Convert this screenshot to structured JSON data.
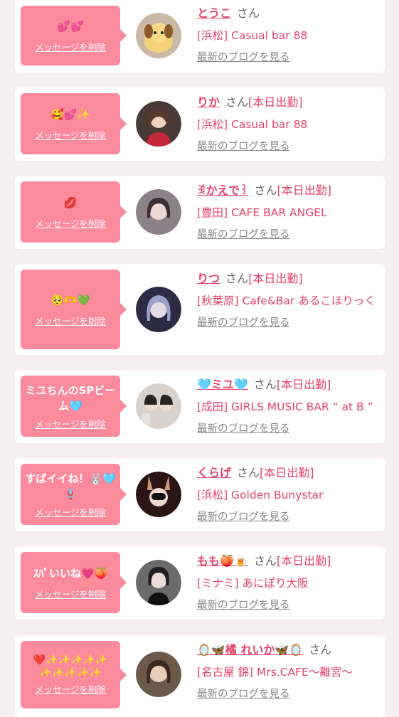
{
  "delete_label": "メッセージを削除",
  "san_label": "さん",
  "blog_label": "最新のブログを見る",
  "cards": [
    {
      "message": "💕💕",
      "name": "とうこ",
      "duty": "",
      "shop": "[浜松] Casual bar 88"
    },
    {
      "message": "🥰💕✨",
      "name": "りか",
      "duty": "[本日出勤]",
      "shop": "[浜松] Casual bar 88"
    },
    {
      "message": "💋",
      "name": "ꉂかえで꒱",
      "duty": "[本日出勤]",
      "shop": "[豊田] CAFE BAR ANGEL"
    },
    {
      "message": "🥺🫶💚",
      "name": "りつ",
      "duty": "[本日出勤]",
      "shop": "[秋葉原] Cafe&Bar あるこほりっく"
    },
    {
      "message": "ミユちんのSPビーム🩵",
      "name": "🩵ミユ🩵",
      "duty": "[本日出勤]",
      "shop": "[成田] GIRLS MUSIC BAR “ at B ”"
    },
    {
      "message": "すばイイね！🐰🩵🪢",
      "name": "くらげ",
      "duty": "[本日出勤]",
      "shop": "[浜松] Golden Bunystar"
    },
    {
      "message": "ｽﾊﾟいいね💗🍑",
      "name": "もも🍑🍺",
      "duty": "[本日出勤]",
      "shop": "[ミナミ] あにぽり大阪"
    },
    {
      "message": "❤️✨✨✨✨✨✨✨✨✨✨",
      "name": "🪞🦋橘 れいか🦋🪞",
      "duty": "",
      "shop": "[名古屋 錦] Mrs.CAFE〜離宮〜"
    }
  ],
  "colors": {
    "bubble": "#fb8a9d",
    "accent": "#e5426b",
    "background": "#f6eef0"
  }
}
